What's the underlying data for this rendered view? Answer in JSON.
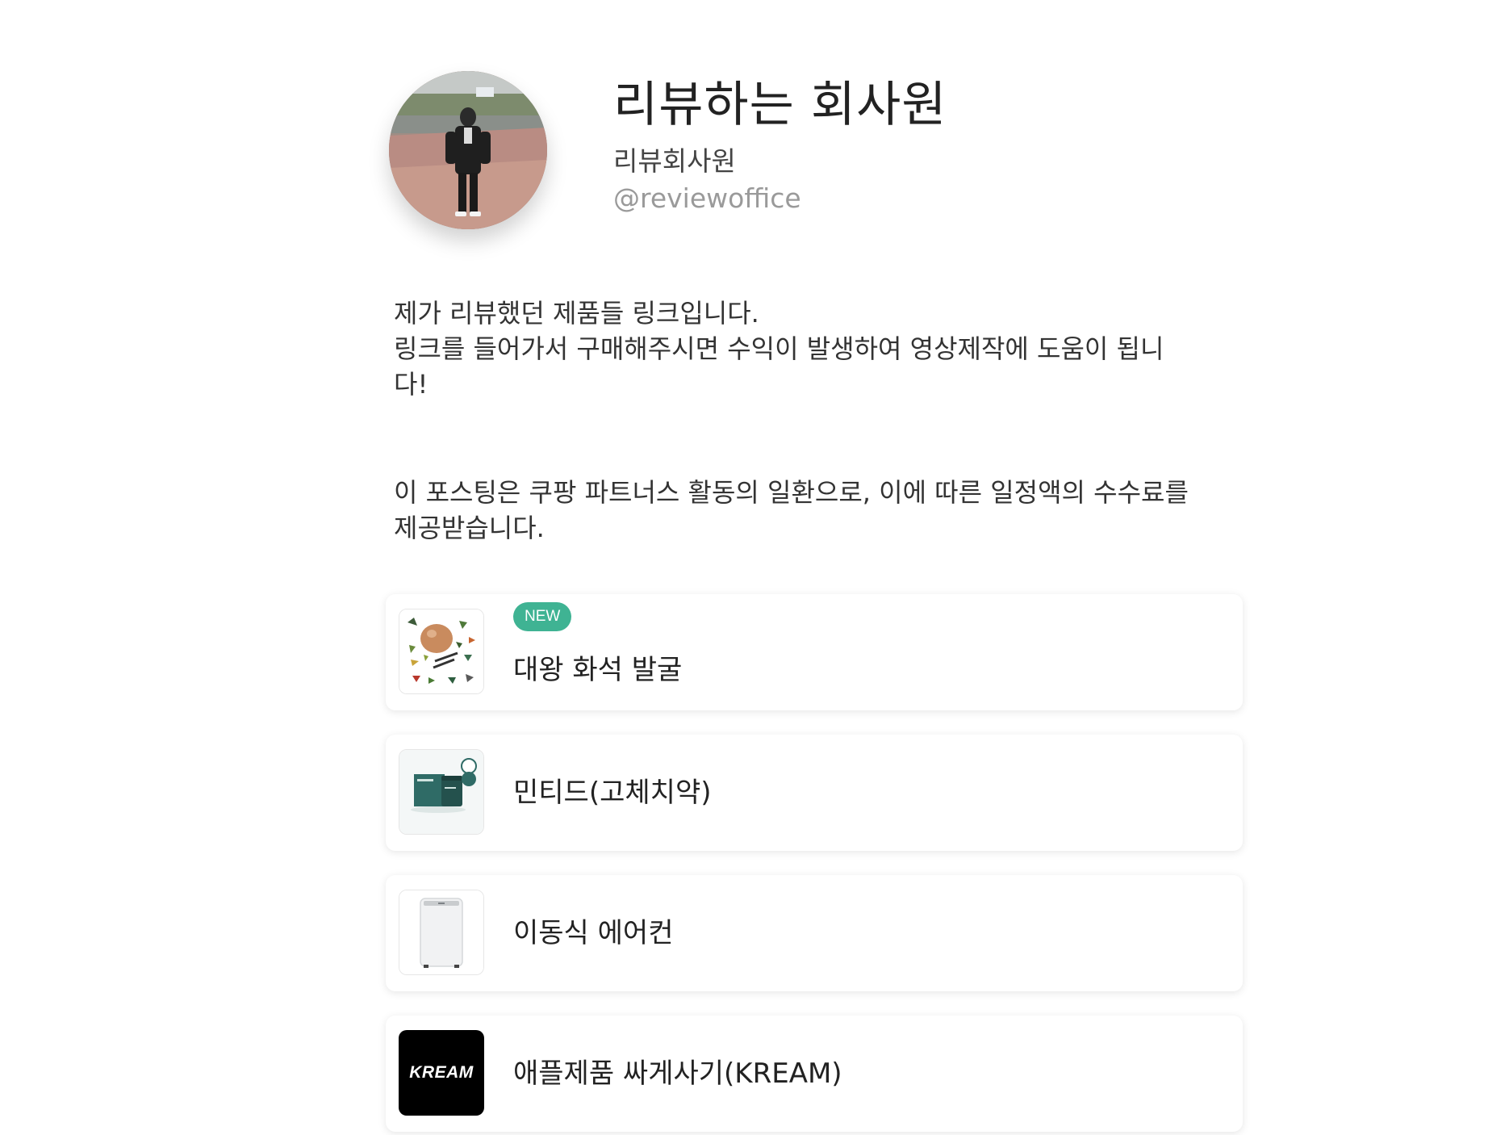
{
  "profile": {
    "name": "리뷰하는 회사원",
    "subtitle": "리뷰회사원",
    "handle": "@reviewoffice"
  },
  "bio": {
    "text": "제가 리뷰했던 제품들 링크입니다.\n링크를 들어가서 구매해주시면 수익이 발생하여 영상제작에 도움이 됩니\n다!"
  },
  "disclosure": {
    "text": "이 포스팅은 쿠팡 파트너스 활동의 일환으로, 이에 따른 일정액의 수수료를 제공받습니다."
  },
  "links": [
    {
      "title": "대왕 화석 발굴",
      "badge": "NEW",
      "icon": "dinosaur-fossil-kit-thumbnail"
    },
    {
      "title": "민티드(고체치약)",
      "icon": "minted-toothpaste-thumbnail"
    },
    {
      "title": "이동식 에어컨",
      "icon": "portable-air-conditioner-thumbnail"
    },
    {
      "title": "애플제품 싸게사기(KREAM)",
      "thumb_text": "KREAM",
      "icon": "kream-logo-thumbnail"
    }
  ],
  "colors": {
    "badge": "#3fb393",
    "handle": "#9a9a9a",
    "kream_bg": "#000000"
  }
}
